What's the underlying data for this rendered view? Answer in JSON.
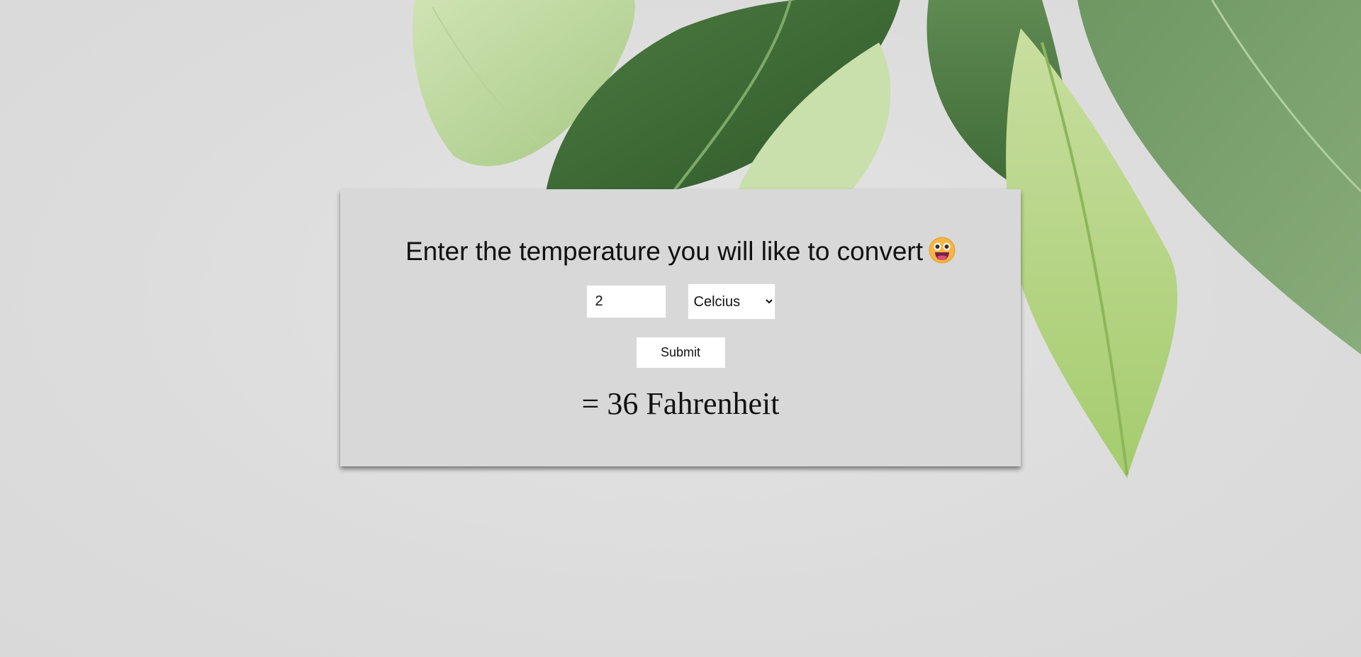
{
  "converter": {
    "heading": "Enter the temperature you will like to convert",
    "emoji_icon": "grinning-face-emoji-icon",
    "input_value": "2",
    "unit_selected": "Celcius",
    "submit_label": "Submit",
    "result_text": "= 36 Fahrenheit"
  },
  "colors": {
    "background": "#dedede",
    "card": "#d8d8d8",
    "leaf_dark": "#3f6b36",
    "leaf_light": "#a9cd82"
  }
}
